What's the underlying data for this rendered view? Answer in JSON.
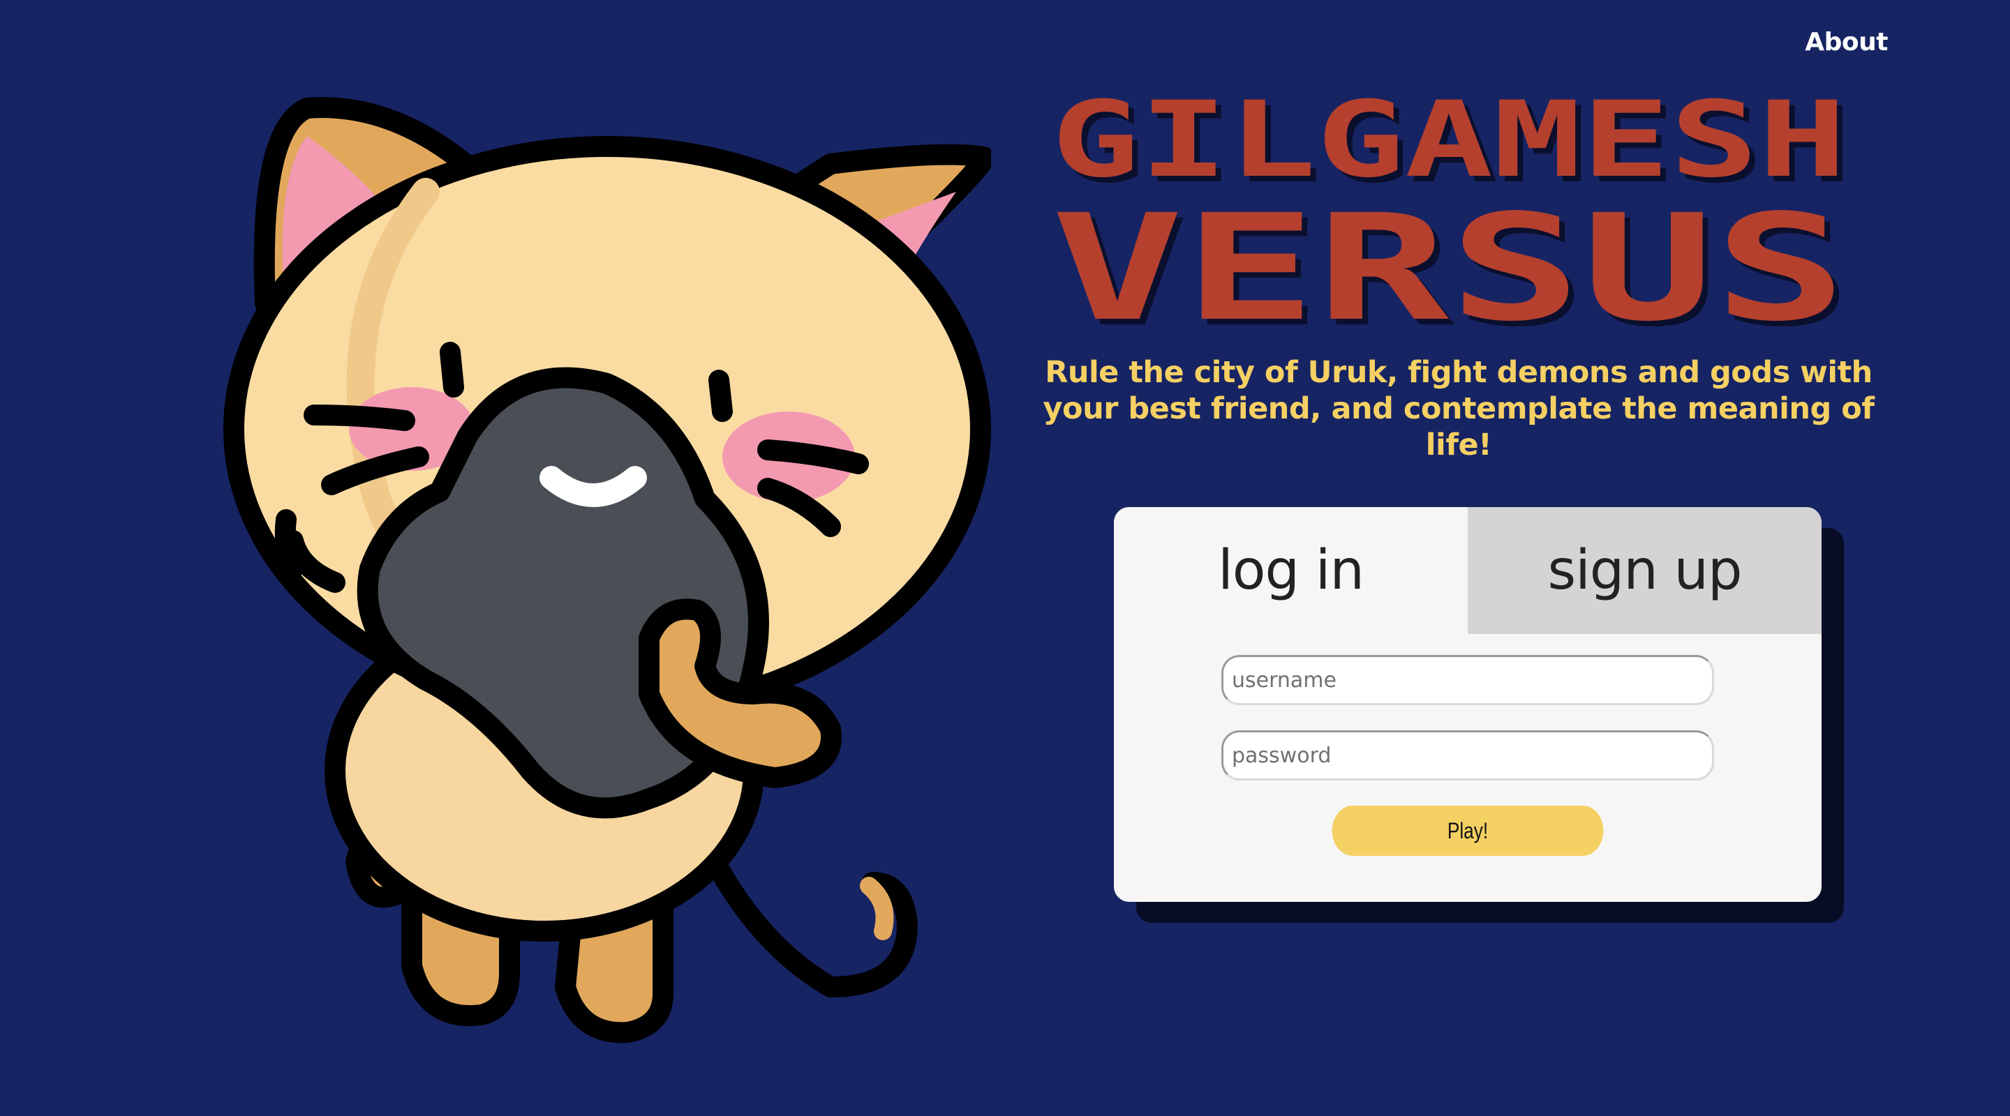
{
  "nav": {
    "about_label": "About"
  },
  "hero": {
    "title_line1": "GILGAMESH",
    "title_line2": "VERSUS",
    "tagline": "Rule the city of Uruk, fight demons and gods with your best friend, and contemplate the meaning of life!"
  },
  "auth": {
    "tabs": [
      {
        "label": "log in",
        "active": true
      },
      {
        "label": "sign up",
        "active": false
      }
    ],
    "username_placeholder": "username",
    "password_placeholder": "password",
    "play_label": "Play!"
  },
  "colors": {
    "background": "#172463",
    "title_red": "#b5402e",
    "title_shadow": "#0a0f2e",
    "accent_yellow": "#f5d063",
    "card_bg": "#f6f6f6",
    "tab_inactive": "#d4d4d4"
  },
  "icons": {
    "mascot": "cat-mascot-icon"
  }
}
